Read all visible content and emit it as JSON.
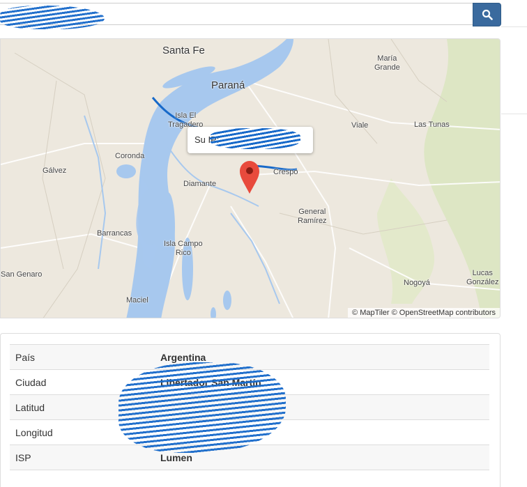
{
  "search": {
    "value": "",
    "button_icon": "search-icon"
  },
  "map": {
    "labels": {
      "santa_fe": "Santa Fe",
      "parana": "Paraná",
      "maria_grande": "María\nGrande",
      "isla_el_tragadero": "Isla El\nTragadero",
      "viale": "Viale",
      "las_tunas": "Las Tunas",
      "coronda": "Coronda",
      "galvez": "Gálvez",
      "diamante": "Diamante",
      "crespo": "Crespo",
      "general_ramirez": "General\nRamírez",
      "barrancas": "Barrancas",
      "isla_campo_rico": "Isla Campo\nRico",
      "san_genaro": "San Genaro",
      "nogoya": "Nogoyá",
      "lucas_gonzalez": "Lucas\nGonzález",
      "maciel": "Maciel"
    },
    "popup_text": "Su IP:",
    "attribution": "© MapTiler © OpenStreetMap contributors",
    "marker_color": "#e84a3c",
    "water_color": "#a7c8ee",
    "land_color": "#ede8de"
  },
  "info": {
    "rows": [
      {
        "key": "País",
        "value": "Argentina"
      },
      {
        "key": "Ciudad",
        "value": "Libertador San Martín"
      },
      {
        "key": "Latitud",
        "value": ""
      },
      {
        "key": "Longitud",
        "value": ""
      },
      {
        "key": "ISP",
        "value": "Lumen"
      }
    ]
  }
}
